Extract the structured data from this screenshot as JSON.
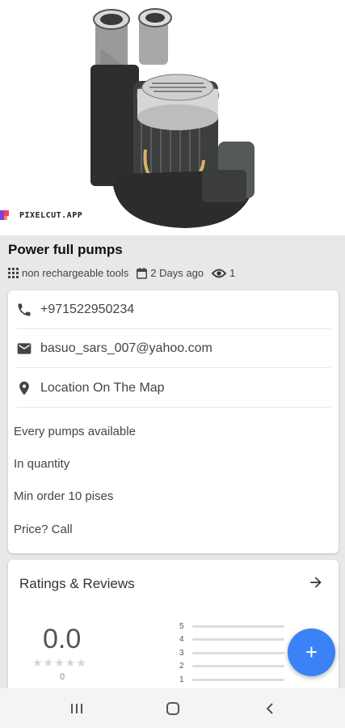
{
  "watermark": {
    "text": "PIXELCUT.APP"
  },
  "listing": {
    "title": "Power full pumps",
    "category": "non rechargeable tools",
    "posted": "2 Days ago",
    "views": "1"
  },
  "contact": {
    "phone": "+971522950234",
    "email": "basuo_sars_007@yahoo.com",
    "location": "Location On The Map"
  },
  "description": {
    "line1": "Every pumps available",
    "line2": "In quantity",
    "line3": "Min order 10 pises",
    "line4": "Price?  Call"
  },
  "ratings": {
    "title": "Ratings & Reviews",
    "score": "0.0",
    "stars": "★★★★★",
    "count": "0",
    "levels": [
      "5",
      "4",
      "3",
      "2",
      "1"
    ]
  },
  "fab": {
    "label": "+"
  },
  "colors": {
    "accent": "#3b82f6",
    "background": "#e8e8e8"
  }
}
